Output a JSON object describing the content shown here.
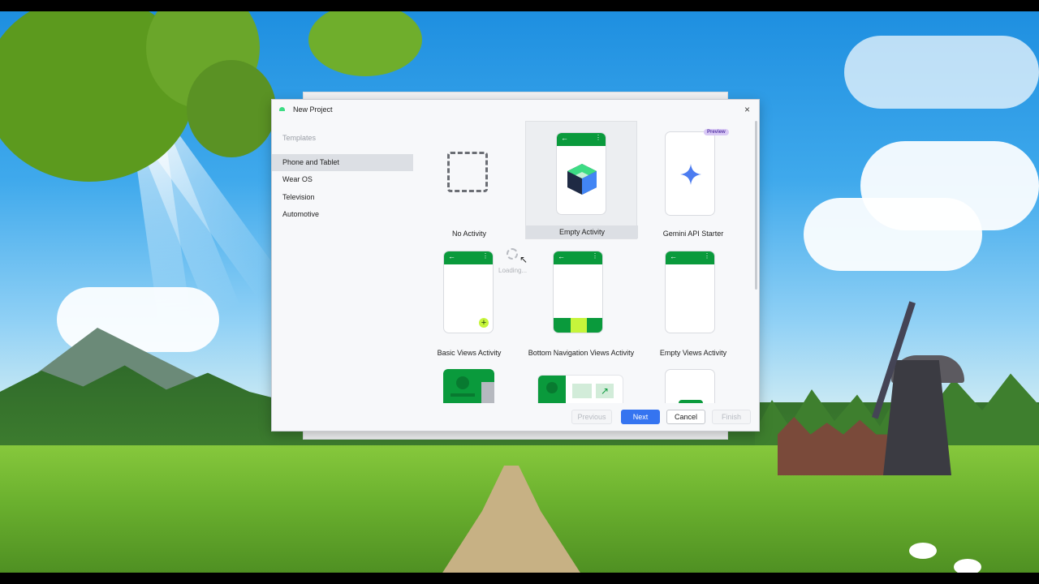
{
  "dialog": {
    "title": "New Project",
    "close_glyph": "×"
  },
  "sidebar": {
    "section_label": "Templates",
    "items": [
      {
        "label": "Phone and Tablet",
        "selected": true
      },
      {
        "label": "Wear OS"
      },
      {
        "label": "Television"
      },
      {
        "label": "Automotive"
      }
    ]
  },
  "templates": [
    {
      "label": "No Activity",
      "icon": "dashed-square-icon"
    },
    {
      "label": "Empty Activity",
      "icon": "android-cube-icon",
      "selected": true
    },
    {
      "label": "Gemini API Starter",
      "icon": "gemini-sparkle-icon",
      "badge": "Preview"
    },
    {
      "label": "Basic Views Activity",
      "icon": "fab-plus-icon"
    },
    {
      "label": "Bottom Navigation Views Activity",
      "icon": "bottom-nav-icon"
    },
    {
      "label": "Empty Views Activity",
      "icon": "blank-phone-icon"
    }
  ],
  "loading": {
    "text": "Loading..."
  },
  "footer": {
    "previous": "Previous",
    "next": "Next",
    "cancel": "Cancel",
    "finish": "Finish"
  },
  "colors": {
    "accent": "#3574f0",
    "phone_bar": "#0a9a3c",
    "preview_badge": "#d9c9f5"
  }
}
